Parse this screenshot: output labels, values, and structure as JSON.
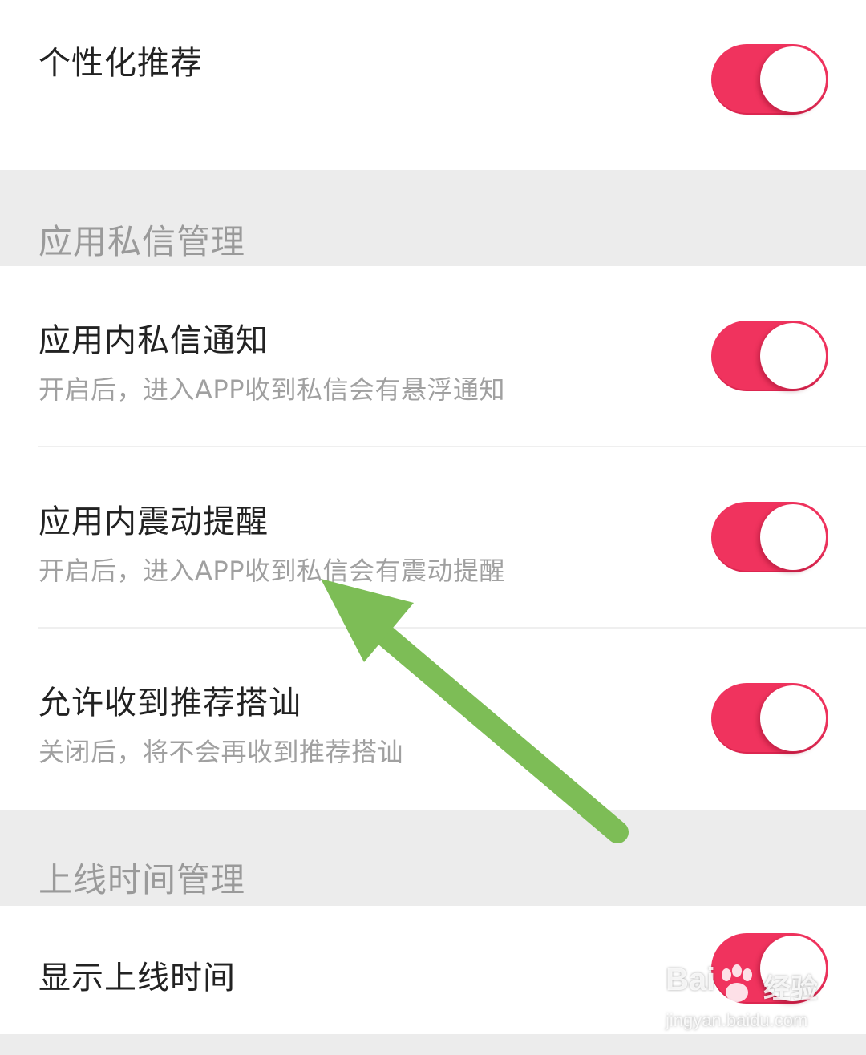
{
  "settings": {
    "personalized": {
      "title": "个性化推荐",
      "enabled": true
    },
    "section_messages": {
      "title": "应用私信管理",
      "items": [
        {
          "title": "应用内私信通知",
          "desc": "开启后，进入APP收到私信会有悬浮通知",
          "enabled": true
        },
        {
          "title": "应用内震动提醒",
          "desc": "开启后，进入APP收到私信会有震动提醒",
          "enabled": true
        },
        {
          "title": "允许收到推荐搭讪",
          "desc": "关闭后，将不会再收到推荐搭讪",
          "enabled": true
        }
      ]
    },
    "section_online": {
      "title": "上线时间管理",
      "items": [
        {
          "title": "显示上线时间",
          "enabled": true
        }
      ]
    }
  },
  "annotation": {
    "arrow_color": "#7dbd56"
  },
  "colors": {
    "toggle_on": "#f0335e",
    "section_bg": "#ececec"
  },
  "watermark": {
    "logo": "Bai",
    "logo_suffix": "经验",
    "url": "jingyan.baidu.com"
  }
}
